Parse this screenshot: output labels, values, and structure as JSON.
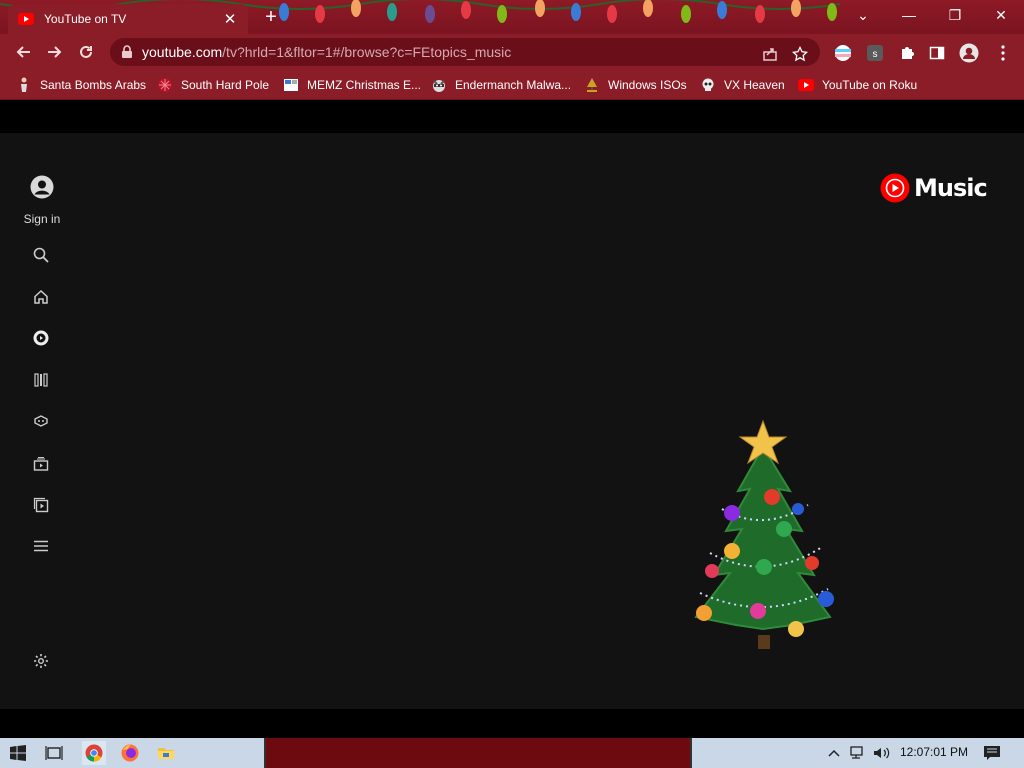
{
  "browser": {
    "tab": {
      "title": "YouTube on TV",
      "close_glyph": "✕"
    },
    "new_tab_glyph": "+",
    "window_controls": {
      "menu": "⌄",
      "minimize": "—",
      "restore": "❐",
      "close": "✕"
    },
    "nav": {
      "back": "back-icon",
      "forward": "forward-icon",
      "reload": "reload-icon"
    },
    "address": {
      "host": "youtube.com",
      "path": "/tv?hrld=1&fltor=1#/browse?c=FEtopics_music"
    },
    "bookmarks": [
      {
        "label": "Santa Bombs Arabs",
        "icon": "figure-icon"
      },
      {
        "label": "South Hard Pole",
        "icon": "snowflake-icon"
      },
      {
        "label": "MEMZ Christmas E...",
        "icon": "page-icon"
      },
      {
        "label": "Endermanch Malwa...",
        "icon": "raccoon-icon"
      },
      {
        "label": "Windows ISOs",
        "icon": "tree-icon"
      },
      {
        "label": "VX Heaven",
        "icon": "skull-icon"
      },
      {
        "label": "YouTube on Roku",
        "icon": "youtube-icon"
      }
    ],
    "theme_colors": {
      "frame": "#8a1d27",
      "omnibox": "#6a0f19"
    }
  },
  "app": {
    "sign_in_label": "Sign in",
    "brand": {
      "word": "Music",
      "color": "#ff0000"
    },
    "nav_icons": [
      "search-icon",
      "home-icon",
      "music-icon",
      "library-icon",
      "gaming-icon",
      "subscriptions-icon",
      "playlist-icon",
      "menu-icon",
      "settings-icon"
    ],
    "background": "#121212"
  },
  "taskbar": {
    "clock": "12:07:01 PM"
  }
}
